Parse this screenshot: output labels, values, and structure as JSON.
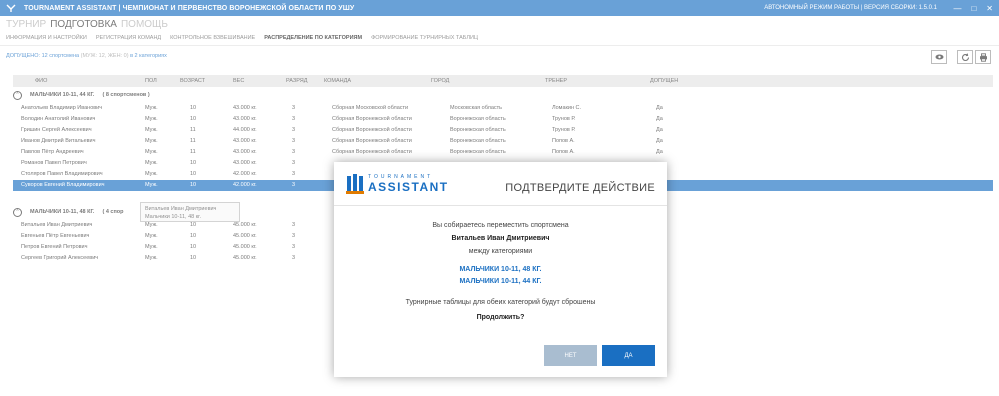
{
  "window": {
    "title": "TOURNAMENT ASSISTANT | ЧЕМПИОНАТ И ПЕРВЕНСТВО ВОРОНЕЖСКОЙ ОБЛАСТИ ПО УШУ",
    "mode": "АВТОНОМНЫЙ РЕЖИМ РАБОТЫ | ВЕРСИЯ СБОРКИ: 1.5.0.1",
    "minimize": "—",
    "maximize": "□",
    "close": "✕"
  },
  "top_menu": [
    "ТУРНИР",
    "ПОДГОТОВКА",
    "ПОМОЩЬ"
  ],
  "sub_menu": [
    "ИНФОРМАЦИЯ И НАСТРОЙКИ",
    "РЕГИСТРАЦИЯ КОМАНД",
    "КОНТРОЛЬНОЕ ВЗВЕШИВАНИЕ",
    "РАСПРЕДЕЛЕНИЕ ПО КАТЕГОРИЯМ",
    "ФОРМИРОВАНИЕ ТУРНИРНЫХ ТАБЛИЦ"
  ],
  "admitted": {
    "label": "ДОПУЩЕНО:",
    "count": "12 спортсмена",
    "detail": "(МУЖ: 12, ЖЕН: 0)",
    "categories": "в 2 категориях"
  },
  "table": {
    "columns": [
      "ФИО",
      "ПОЛ",
      "ВОЗРАСТ",
      "ВЕС",
      "РАЗРЯД",
      "КОМАНДА",
      "ГОРОД",
      "ТРЕНЕР",
      "ДОПУЩЕН"
    ],
    "group1": {
      "name": "МАЛЬЧИКИ 10-11, 44 КГ.",
      "count": "( 8 спортсменов )"
    },
    "group1_rows": [
      [
        "Анатольев Владимир Иванович",
        "Муж.",
        "10",
        "43.000 кг.",
        "3",
        "Сборная Московской области",
        "Московская область",
        "Ломакин С.",
        "Да"
      ],
      [
        "Володин Анатолий Иванович",
        "Муж.",
        "10",
        "43.000 кг.",
        "3",
        "Сборная Воронежской области",
        "Воронежская область",
        "Трунов Р.",
        "Да"
      ],
      [
        "Гришин Сергей Алексеевич",
        "Муж.",
        "11",
        "44.000 кг.",
        "3",
        "Сборная Воронежской области",
        "Воронежская область",
        "Трунов Р.",
        "Да"
      ],
      [
        "Иванов Дмитрий Витальевич",
        "Муж.",
        "11",
        "43.000 кг.",
        "3",
        "Сборная Воронежской области",
        "Воронежская область",
        "Попов А.",
        "Да"
      ],
      [
        "Павлов Пётр Андреевич",
        "Муж.",
        "11",
        "43.000 кг.",
        "3",
        "Сборная Воронежской области",
        "Воронежская область",
        "Попов А.",
        "Да"
      ],
      [
        "Романов Павел Петрович",
        "Муж.",
        "10",
        "43.000 кг.",
        "3",
        "",
        "",
        "",
        ""
      ],
      [
        "Столяров Павел Владимирович",
        "Муж.",
        "10",
        "42.000 кг.",
        "3",
        "",
        "",
        "",
        ""
      ],
      [
        "Суворов Евгений Владимирович",
        "Муж.",
        "10",
        "42.000 кг.",
        "3",
        "",
        "",
        "",
        ""
      ]
    ],
    "group2": {
      "name": "МАЛЬЧИКИ 10-11, 48 КГ.",
      "count": "( 4 спор"
    },
    "group2_rows": [
      [
        "Витальев Иван Дмитриевич",
        "Муж.",
        "10",
        "45.000 кг.",
        "3"
      ],
      [
        "Евгеньев Пётр Евгеньевич",
        "Муж.",
        "10",
        "45.000 кг.",
        "3"
      ],
      [
        "Петров Евгений Петрович",
        "Муж.",
        "10",
        "45.000 кг.",
        "3"
      ],
      [
        "Сергеев Григорий Алексеевич",
        "Муж.",
        "10",
        "45.000 кг.",
        "3"
      ]
    ]
  },
  "tooltip": {
    "line1": "Витальев Иван Дмитриевич",
    "line2": "Мальчики 10-11, 48 кг."
  },
  "dialog": {
    "logo_small": "TOURNAMENT",
    "logo_big": "ASSISTANT",
    "title": "ПОДТВЕРДИТЕ ДЕЙСТВИЕ",
    "line1": "Вы собираетесь переместить спортсмена",
    "athlete": "Витальев Иван Дмитриевич",
    "between": "между категориями",
    "from_category": "МАЛЬЧИКИ 10-11, 48 КГ.",
    "to_category": "МАЛЬЧИКИ 10-11, 44 КГ.",
    "reset_note": "Турнирные таблицы для обеих категорий будут сброшены",
    "question": "Продолжить?",
    "no_label": "НЕТ",
    "yes_label": "ДА"
  },
  "colors": {
    "accent": "#1a6fc2",
    "no_button": "#a9bdd0"
  }
}
